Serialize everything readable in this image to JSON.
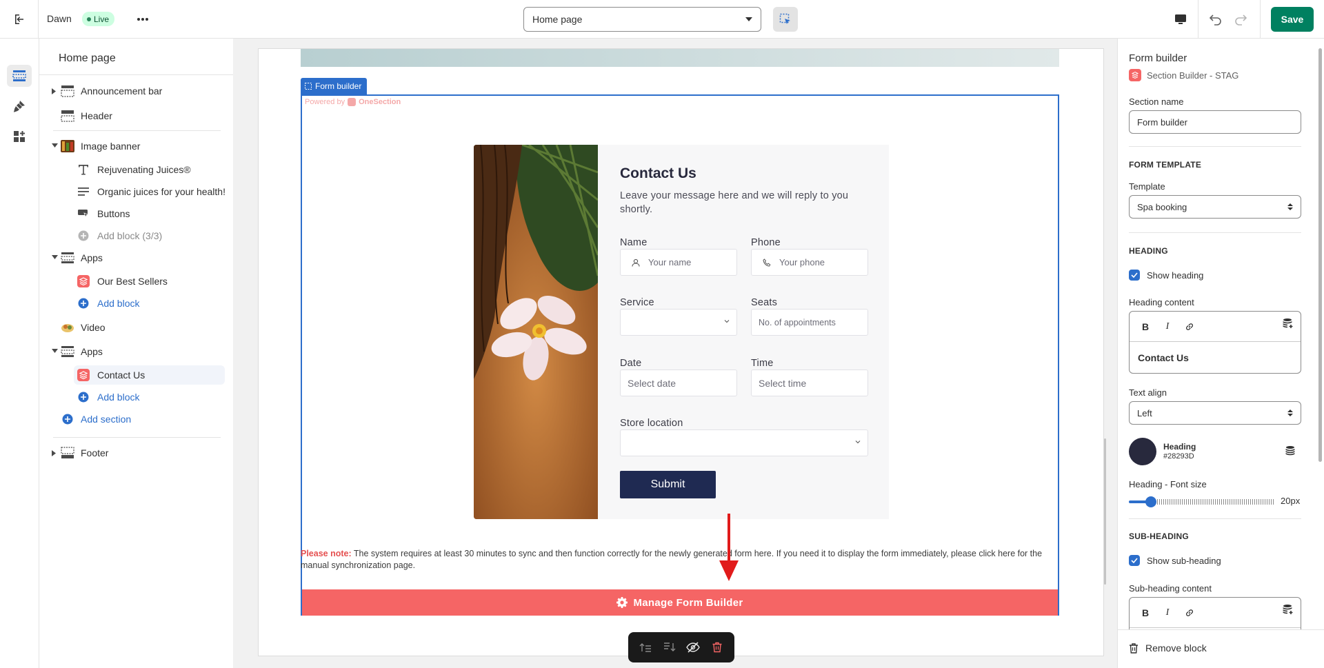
{
  "topbar": {
    "theme_name": "Dawn",
    "live_label": "Live",
    "page_select_value": "Home page",
    "save_label": "Save"
  },
  "sidebar": {
    "title": "Home page",
    "items": [
      {
        "label": "Announcement bar"
      },
      {
        "label": "Header"
      },
      {
        "label": "Image banner"
      },
      {
        "label": "Rejuvenating Juices®"
      },
      {
        "label": "Organic juices for your health!"
      },
      {
        "label": "Buttons"
      },
      {
        "label": "Add block (3/3)"
      },
      {
        "label": "Apps"
      },
      {
        "label": "Our Best Sellers"
      },
      {
        "label": "Add block"
      },
      {
        "label": "Video"
      },
      {
        "label": "Apps"
      },
      {
        "label": "Contact Us"
      },
      {
        "label": "Add block"
      },
      {
        "label": "Add section"
      },
      {
        "label": "Footer"
      }
    ]
  },
  "preview": {
    "section_tag": "Form builder",
    "powered_by": "Powered by",
    "powered_brand": "OneSection",
    "form": {
      "title": "Contact Us",
      "subtitle": "Leave your message here and we will reply to you shortly.",
      "name_label": "Name",
      "name_placeholder": "Your name",
      "phone_label": "Phone",
      "phone_placeholder": "Your phone",
      "service_label": "Service",
      "seats_label": "Seats",
      "seats_placeholder": "No. of appointments",
      "date_label": "Date",
      "date_placeholder": "Select date",
      "time_label": "Time",
      "time_placeholder": "Select time",
      "store_label": "Store location",
      "submit_label": "Submit"
    },
    "note_prefix": "Please note:",
    "note_text": " The system requires at least 30 minutes to sync and then function correctly for the newly generated form here. If you need it to display the form immediately, please click here for the manual synchronization page.",
    "manage_label": "Manage Form Builder"
  },
  "rpanel": {
    "title": "Form builder",
    "app_name": "Section Builder - STAG",
    "section_name_label": "Section name",
    "section_name_value": "Form builder",
    "form_template_heading": "FORM TEMPLATE",
    "template_label": "Template",
    "template_value": "Spa booking",
    "heading_heading": "HEADING",
    "show_heading_label": "Show heading",
    "heading_content_label": "Heading content",
    "heading_content_value": "Contact Us",
    "text_align_label": "Text align",
    "text_align_value": "Left",
    "color_name": "Heading",
    "color_hex": "#28293D",
    "font_size_label": "Heading - Font size",
    "font_size_value": "20px",
    "font_size_fraction": 0.15,
    "subheading_heading": "SUB-HEADING",
    "show_subheading_label": "Show sub-heading",
    "subheading_content_label": "Sub-heading content",
    "remove_label": "Remove block"
  },
  "colors": {
    "accent": "#2c6ecb",
    "save": "#008060",
    "manage_bar": "#f56565",
    "submit": "#1f2a52",
    "heading_color": "#28293D"
  }
}
